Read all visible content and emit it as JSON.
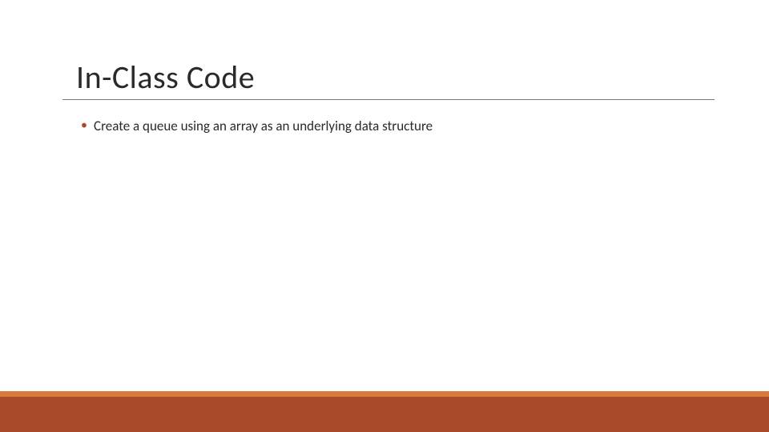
{
  "slide": {
    "title": "In-Class Code",
    "bullets": [
      "Create a queue using an array as an underlying data structure"
    ]
  },
  "theme": {
    "accent_dark": "#a84b2a",
    "accent_light": "#d97a3a",
    "text_color": "#2a2a2a"
  }
}
